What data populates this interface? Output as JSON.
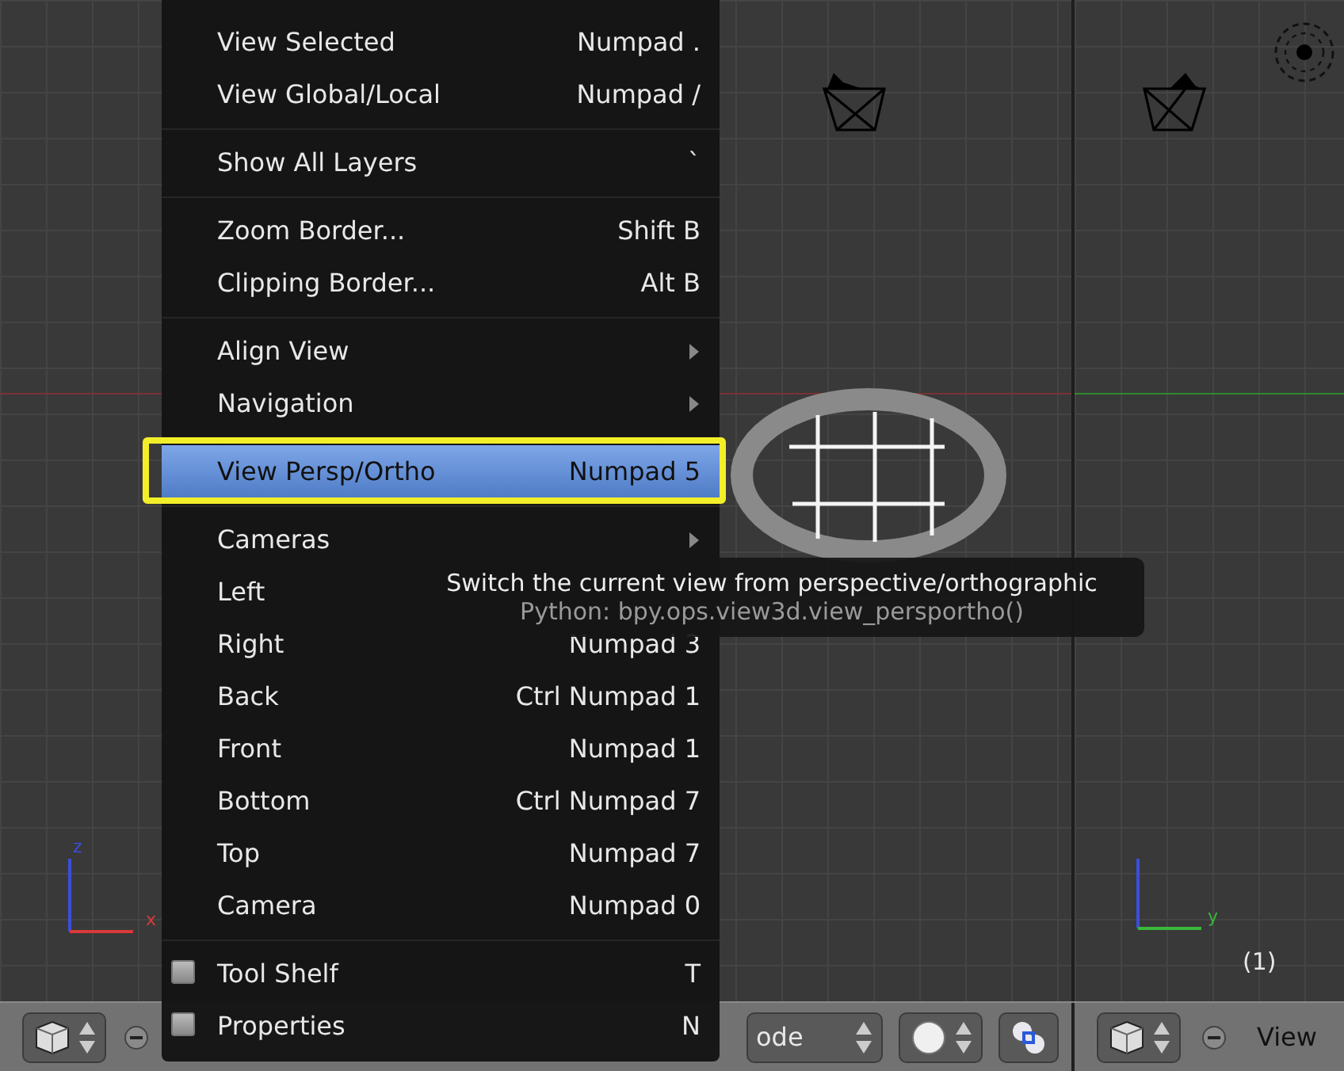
{
  "menu": {
    "items": [
      {
        "kind": "command",
        "label": "View Selected",
        "shortcut": "Numpad .",
        "highlighted": false
      },
      {
        "kind": "command",
        "label": "View Global/Local",
        "shortcut": "Numpad /",
        "highlighted": false
      },
      {
        "kind": "separator"
      },
      {
        "kind": "command",
        "label": "Show All Layers",
        "shortcut": "`",
        "highlighted": false
      },
      {
        "kind": "separator"
      },
      {
        "kind": "command",
        "label": "Zoom Border...",
        "shortcut": "Shift B",
        "highlighted": false
      },
      {
        "kind": "command",
        "label": "Clipping Border...",
        "shortcut": "Alt B",
        "highlighted": false
      },
      {
        "kind": "separator"
      },
      {
        "kind": "submenu",
        "label": "Align View",
        "highlighted": false
      },
      {
        "kind": "submenu",
        "label": "Navigation",
        "highlighted": false
      },
      {
        "kind": "separator"
      },
      {
        "kind": "command",
        "label": "View Persp/Ortho",
        "shortcut": "Numpad 5",
        "highlighted": true
      },
      {
        "kind": "separator"
      },
      {
        "kind": "submenu",
        "label": "Cameras",
        "highlighted": false
      },
      {
        "kind": "command",
        "label": "Left",
        "highlighted": false
      },
      {
        "kind": "command",
        "label": "Right",
        "shortcut": "Numpad 3",
        "highlighted": false
      },
      {
        "kind": "command",
        "label": "Back",
        "shortcut": "Ctrl Numpad 1",
        "highlighted": false
      },
      {
        "kind": "command",
        "label": "Front",
        "shortcut": "Numpad 1",
        "highlighted": false
      },
      {
        "kind": "command",
        "label": "Bottom",
        "shortcut": "Ctrl Numpad 7",
        "highlighted": false
      },
      {
        "kind": "command",
        "label": "Top",
        "shortcut": "Numpad 7",
        "highlighted": false
      },
      {
        "kind": "command",
        "label": "Camera",
        "shortcut": "Numpad 0",
        "highlighted": false
      },
      {
        "kind": "separator"
      },
      {
        "kind": "toggle",
        "label": "Tool Shelf",
        "shortcut": "T",
        "checked": false,
        "highlighted": false
      },
      {
        "kind": "toggle",
        "label": "Properties",
        "shortcut": "N",
        "checked": false,
        "highlighted": false
      }
    ]
  },
  "tooltip": {
    "description": "Switch the current view from perspective/orthographic",
    "python": "Python: bpy.ops.view3d.view_persportho()"
  },
  "viewport_left": {
    "axis_labels": [
      {
        "text": "z",
        "color": "#3a4fd8"
      },
      {
        "text": "x",
        "color": "#d83a3a"
      }
    ]
  },
  "viewport_right": {
    "axis_labels": [
      {
        "text": "y",
        "color": "#3ab83a"
      }
    ],
    "frame_label": "(1)"
  },
  "header": {
    "mode_dropdown": {
      "label": "ode"
    },
    "right_menu": {
      "label": "View"
    }
  }
}
